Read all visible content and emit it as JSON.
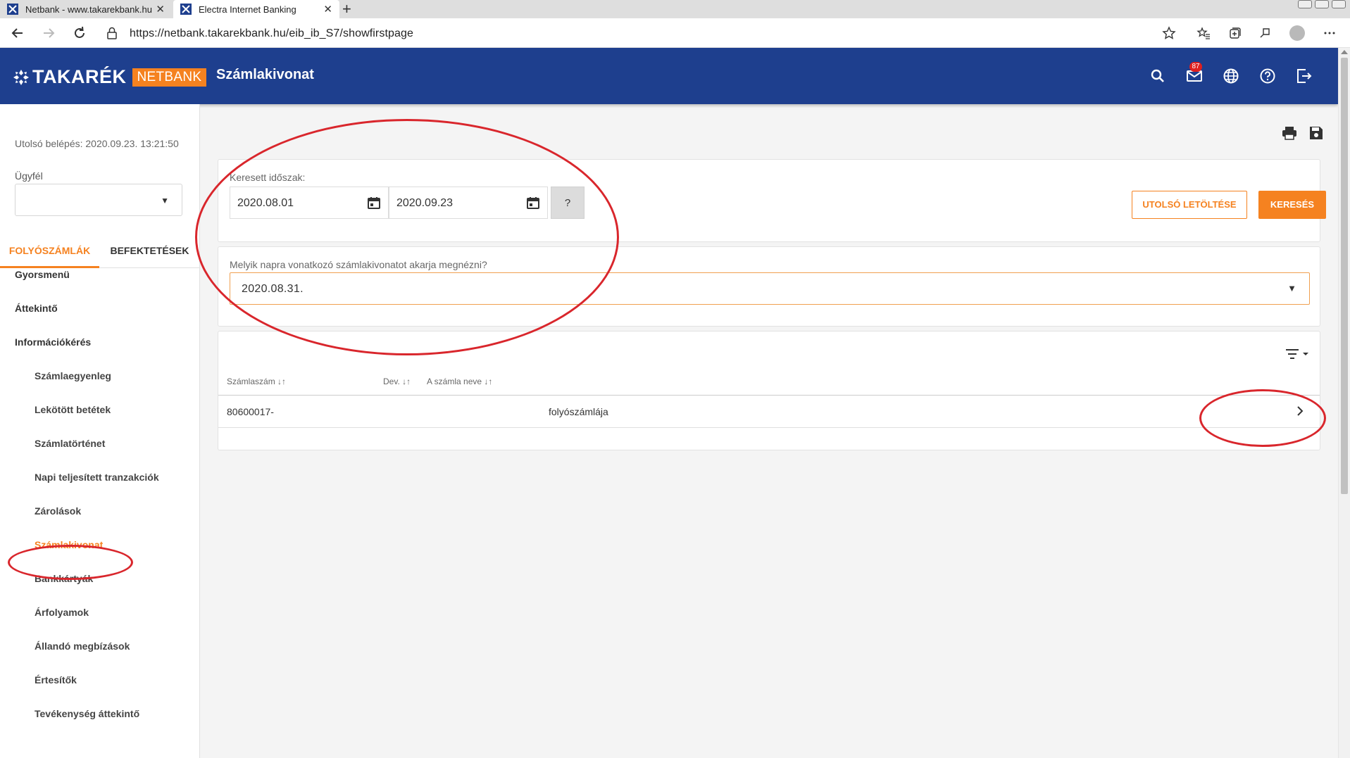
{
  "browser": {
    "tabs": [
      {
        "title": "Netbank - www.takarekbank.hu",
        "active": false
      },
      {
        "title": "Electra Internet Banking",
        "active": true
      }
    ],
    "close_glyph": "✕",
    "new_tab_glyph": "+",
    "url": "https://netbank.takarekbank.hu/eib_ib_S7/showfirstpage"
  },
  "header": {
    "logo_word": "TAKARÉK",
    "logo_badge": "NETBANK",
    "page_title": "Számlakivonat",
    "notification_count": "87",
    "icons": [
      "search-icon",
      "mail-icon",
      "globe-icon",
      "help-icon",
      "logout-icon"
    ],
    "colors": {
      "header_bg": "#1e3f8e",
      "accent": "#f58220"
    }
  },
  "sidebar": {
    "last_login": "Utolsó belépés: 2020.09.23. 13:21:50",
    "client_label": "Ügyfél",
    "client_value": "",
    "tabs": [
      {
        "label": "FOLYÓSZÁMLÁK",
        "active": true
      },
      {
        "label": "BEFEKTETÉSEK",
        "active": false
      }
    ],
    "menu": [
      {
        "label": "Gyorsmenü",
        "level": 1
      },
      {
        "label": "Áttekintő",
        "level": 1
      },
      {
        "label": "Információkérés",
        "level": 1
      },
      {
        "label": "Számlaegyenleg",
        "level": 2
      },
      {
        "label": "Lekötött betétek",
        "level": 2
      },
      {
        "label": "Számlatörténet",
        "level": 2
      },
      {
        "label": "Napi teljesített tranzakciók",
        "level": 2
      },
      {
        "label": "Zárolások",
        "level": 2
      },
      {
        "label": "Számlakivonat",
        "level": 2,
        "active": true
      },
      {
        "label": "Bankkártyák",
        "level": 2
      },
      {
        "label": "Árfolyamok",
        "level": 2
      },
      {
        "label": "Állandó megbízások",
        "level": 2
      },
      {
        "label": "Értesítők",
        "level": 2
      },
      {
        "label": "Tevékenység áttekintő",
        "level": 2
      }
    ]
  },
  "main": {
    "toolbar_icons": [
      "print-icon",
      "save-icon"
    ],
    "search_period": {
      "label": "Keresett időszak:",
      "from": "2020.08.01",
      "to": "2020.09.23",
      "help_label": "?"
    },
    "last_download_label": "UTOLSÓ LETÖLTÉSE",
    "search_label": "KERESÉS",
    "statement": {
      "label": "Melyik napra vonatkozó számlakivonatot akarja megnézni?",
      "value": "2020.08.31."
    },
    "table": {
      "columns": [
        {
          "label": "Számlaszám",
          "sort": "↓↑"
        },
        {
          "label": "Dev.",
          "sort": "↓↑"
        },
        {
          "label": "A számla neve",
          "sort": "↓↑"
        }
      ],
      "rows": [
        {
          "account": "80600017-",
          "currency": "",
          "name": "folyószámlája"
        }
      ]
    }
  },
  "dropdown_glyph": "▼",
  "annotation_color": "#d9262c"
}
